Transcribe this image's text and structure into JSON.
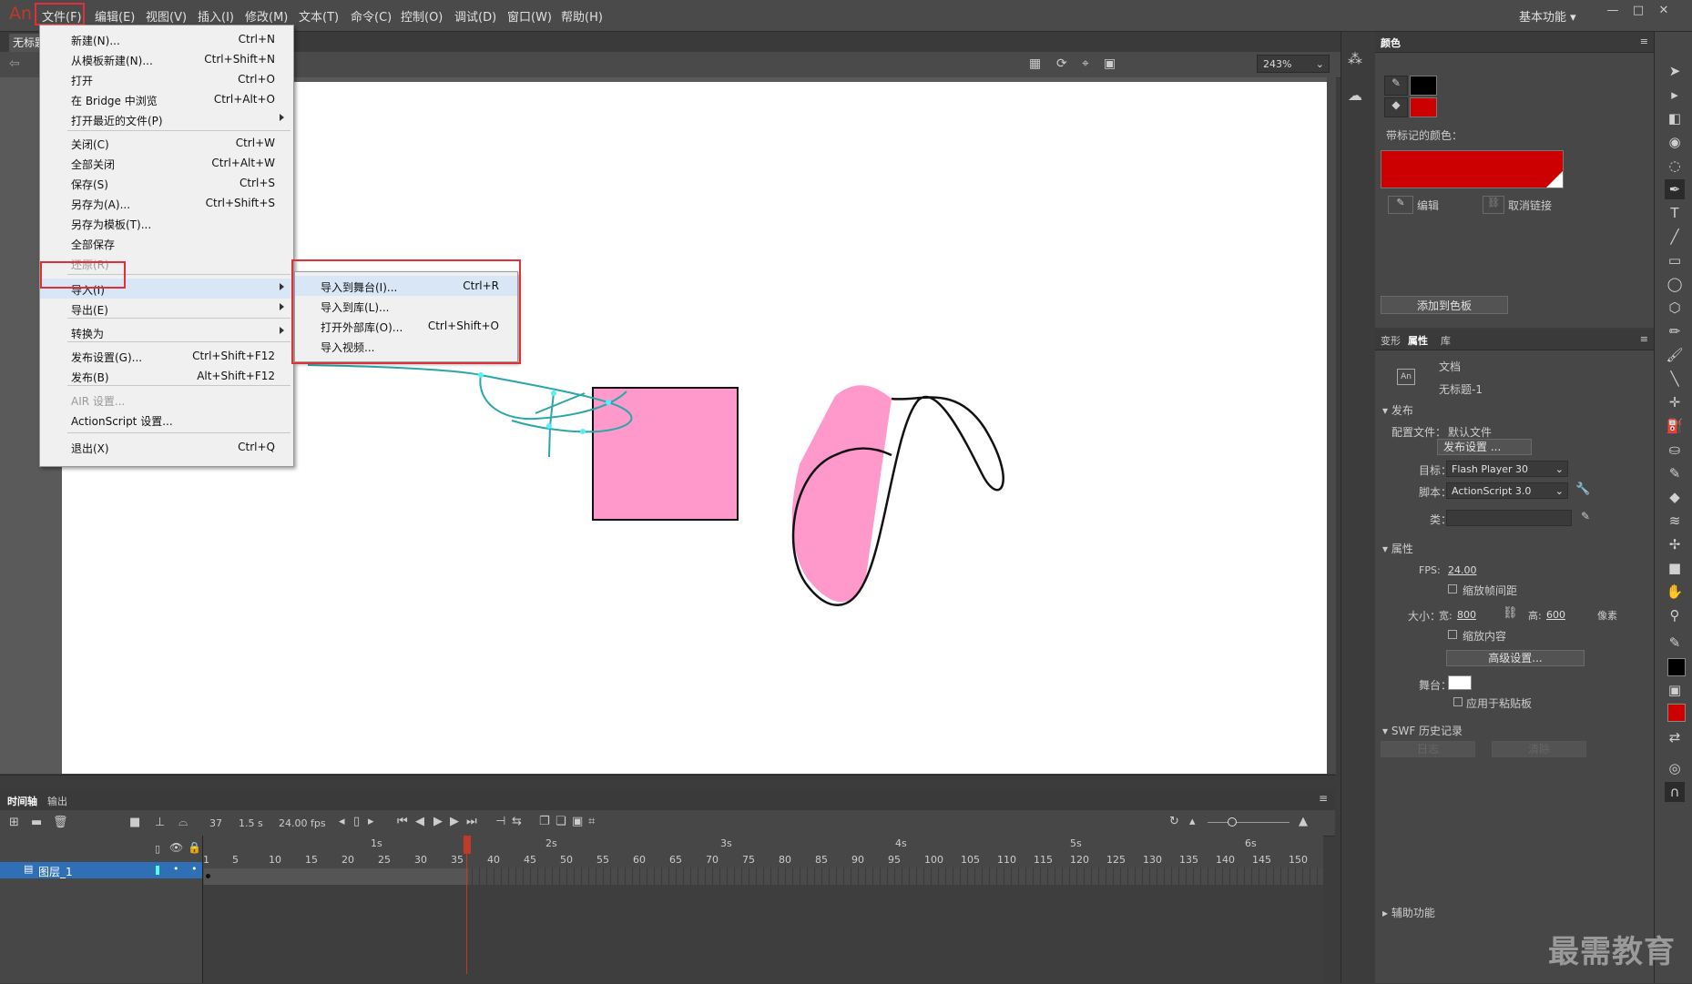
{
  "app": {
    "logo": "An",
    "workspace": "基本功能"
  },
  "menubar": {
    "items": [
      "文件(F)",
      "编辑(E)",
      "视图(V)",
      "插入(I)",
      "修改(M)",
      "文本(T)",
      "命令(C)",
      "控制(O)",
      "调试(D)",
      "窗口(W)",
      "帮助(H)"
    ]
  },
  "doc_tab": "无标题",
  "zoom": "243%",
  "file_menu": {
    "items": [
      {
        "label": "新建(N)...",
        "shortcut": "Ctrl+N"
      },
      {
        "label": "从模板新建(N)...",
        "shortcut": "Ctrl+Shift+N"
      },
      {
        "label": "打开",
        "shortcut": "Ctrl+O"
      },
      {
        "label": "在 Bridge 中浏览",
        "shortcut": "Ctrl+Alt+O"
      },
      {
        "label": "打开最近的文件(P)",
        "shortcut": ""
      },
      {
        "label": "关闭(C)",
        "shortcut": "Ctrl+W"
      },
      {
        "label": "全部关闭",
        "shortcut": "Ctrl+Alt+W"
      },
      {
        "label": "保存(S)",
        "shortcut": "Ctrl+S"
      },
      {
        "label": "另存为(A)...",
        "shortcut": "Ctrl+Shift+S"
      },
      {
        "label": "另存为模板(T)...",
        "shortcut": ""
      },
      {
        "label": "全部保存",
        "shortcut": ""
      },
      {
        "label": "还原(R)",
        "shortcut": ""
      },
      {
        "label": "导入(I)",
        "shortcut": ""
      },
      {
        "label": "导出(E)",
        "shortcut": ""
      },
      {
        "label": "转换为",
        "shortcut": ""
      },
      {
        "label": "发布设置(G)...",
        "shortcut": "Ctrl+Shift+F12"
      },
      {
        "label": "发布(B)",
        "shortcut": "Alt+Shift+F12"
      },
      {
        "label": "AIR 设置...",
        "shortcut": ""
      },
      {
        "label": "ActionScript 设置...",
        "shortcut": ""
      },
      {
        "label": "退出(X)",
        "shortcut": "Ctrl+Q"
      }
    ]
  },
  "import_submenu": {
    "items": [
      {
        "label": "导入到舞台(I)...",
        "shortcut": "Ctrl+R"
      },
      {
        "label": "导入到库(L)...",
        "shortcut": ""
      },
      {
        "label": "打开外部库(O)...",
        "shortcut": "Ctrl+Shift+O"
      },
      {
        "label": "导入视频...",
        "shortcut": ""
      }
    ]
  },
  "color_panel": {
    "tab": "颜色",
    "swatch_label": "带标记的颜色：",
    "edit": "编辑",
    "unlink": "取消链接",
    "add_swatch": "添加到色板",
    "stroke_color": "#000000",
    "fill_color": "#cc0000"
  },
  "props_panel": {
    "tabs": [
      "变形",
      "属性",
      "库"
    ],
    "doc_type": "文档",
    "doc_name": "无标题-1",
    "publish_section": "发布",
    "profile_label": "配置文件：",
    "profile_value": "默认文件",
    "publish_settings_btn": "发布设置 ...",
    "target_label": "目标：",
    "target_value": "Flash Player 30",
    "script_label": "脚本：",
    "script_value": "ActionScript 3.0",
    "class_label": "类：",
    "properties_section": "属性",
    "fps_label": "FPS:",
    "fps_value": "24.00",
    "scale_spans": "缩放帧间距",
    "size_label": "大小：",
    "width_label": "宽:",
    "width_value": "800",
    "height_label": "高:",
    "height_value": "600",
    "unit": "像素",
    "scale_content": "缩放内容",
    "advanced_btn": "高级设置...",
    "stage_label": "舞台：",
    "apply_clipboard": "应用于粘贴板",
    "swf_history": "SWF 历史记录",
    "log_btn": "日志",
    "clear_btn": "清除",
    "accessibility": "辅助功能"
  },
  "timeline": {
    "tabs": [
      "时间轴",
      "输出"
    ],
    "frame": "37",
    "time": "1.5 s",
    "fps": "24.00 fps",
    "seconds": [
      "1s",
      "2s",
      "3s",
      "4s",
      "5s",
      "6s"
    ],
    "frame_ticks": [
      "1",
      "5",
      "10",
      "15",
      "20",
      "25",
      "30",
      "35",
      "40",
      "45",
      "50",
      "55",
      "60",
      "65",
      "70",
      "75",
      "80",
      "85",
      "90",
      "95",
      "100",
      "105",
      "110",
      "115",
      "120",
      "125",
      "130",
      "135",
      "140",
      "145",
      "150"
    ],
    "layer_name": "图层_1"
  },
  "watermark": "最需教育"
}
